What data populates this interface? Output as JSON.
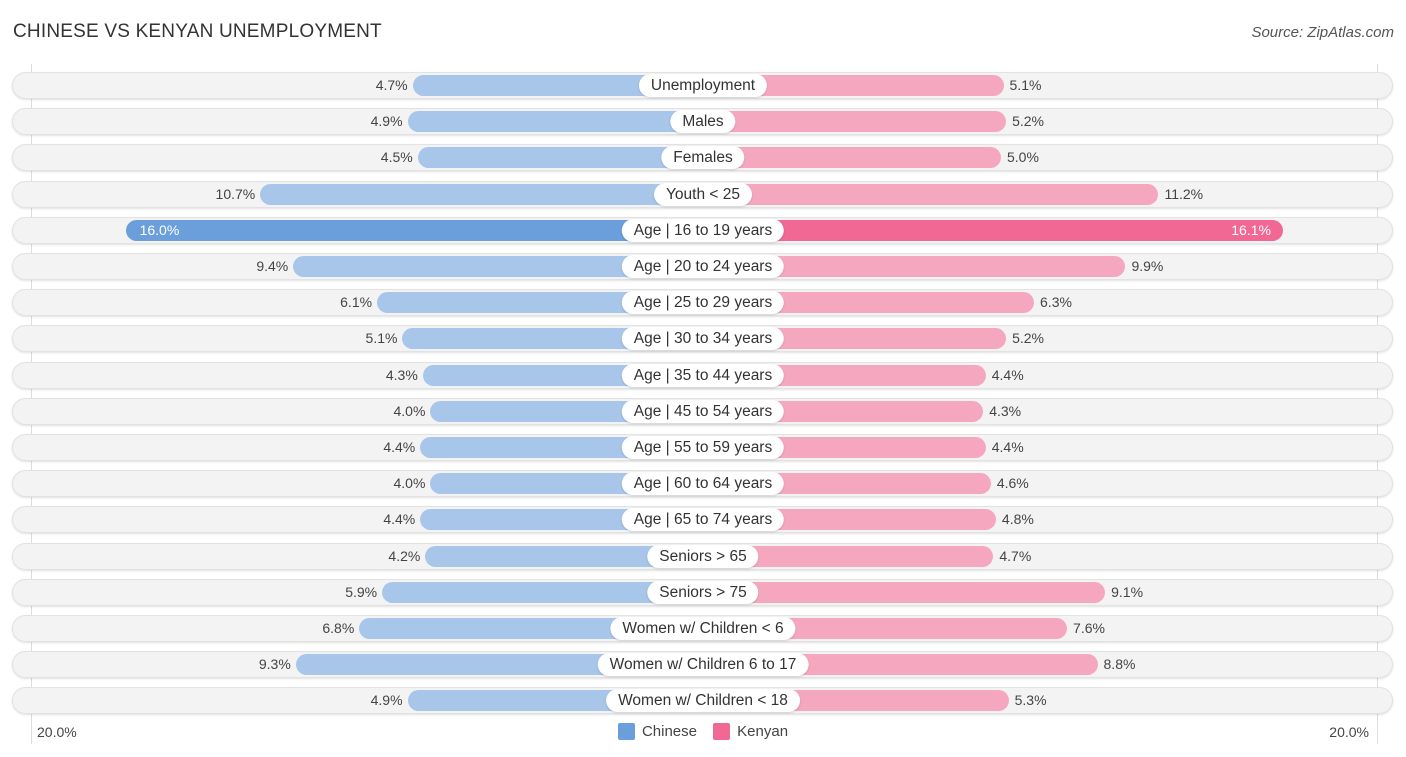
{
  "title": "CHINESE VS KENYAN UNEMPLOYMENT",
  "source": "Source: ZipAtlas.com",
  "colors": {
    "chinese": "#6a9fdc",
    "kenyan": "#f06893",
    "chinese_light": "#a7c6ea",
    "kenyan_light": "#f6a7c0"
  },
  "chart_data": {
    "type": "bar",
    "orientation": "horizontal-diverging",
    "title": "CHINESE VS KENYAN UNEMPLOYMENT",
    "categories": [
      "Unemployment",
      "Males",
      "Females",
      "Youth < 25",
      "Age | 16 to 19 years",
      "Age | 20 to 24 years",
      "Age | 25 to 29 years",
      "Age | 30 to 34 years",
      "Age | 35 to 44 years",
      "Age | 45 to 54 years",
      "Age | 55 to 59 years",
      "Age | 60 to 64 years",
      "Age | 65 to 74 years",
      "Seniors > 65",
      "Seniors > 75",
      "Women w/ Children < 6",
      "Women w/ Children 6 to 17",
      "Women w/ Children < 18"
    ],
    "series": [
      {
        "name": "Chinese",
        "side": "left",
        "values": [
          4.7,
          4.9,
          4.5,
          10.7,
          16.0,
          9.4,
          6.1,
          5.1,
          4.3,
          4.0,
          4.4,
          4.0,
          4.4,
          4.2,
          5.9,
          6.8,
          9.3,
          4.9
        ]
      },
      {
        "name": "Kenyan",
        "side": "right",
        "values": [
          5.1,
          5.2,
          5.0,
          11.2,
          16.1,
          9.9,
          6.3,
          5.2,
          4.4,
          4.3,
          4.4,
          4.6,
          4.8,
          4.7,
          9.1,
          7.6,
          8.8,
          5.3
        ]
      }
    ],
    "value_labels_left": [
      "4.7%",
      "4.9%",
      "4.5%",
      "10.7%",
      "16.0%",
      "9.4%",
      "6.1%",
      "5.1%",
      "4.3%",
      "4.0%",
      "4.4%",
      "4.0%",
      "4.4%",
      "4.2%",
      "5.9%",
      "6.8%",
      "9.3%",
      "4.9%"
    ],
    "value_labels_right": [
      "5.1%",
      "5.2%",
      "5.0%",
      "11.2%",
      "16.1%",
      "9.9%",
      "6.3%",
      "5.2%",
      "4.4%",
      "4.3%",
      "4.4%",
      "4.6%",
      "4.8%",
      "4.7%",
      "9.1%",
      "7.6%",
      "8.8%",
      "5.3%"
    ],
    "highlight_index": 4,
    "axis": {
      "left_label": "20.0%",
      "right_label": "20.0%",
      "max": 20.0
    },
    "legend": [
      {
        "name": "Chinese"
      },
      {
        "name": "Kenyan"
      }
    ],
    "legend_position": "bottom-center",
    "grid": false
  }
}
